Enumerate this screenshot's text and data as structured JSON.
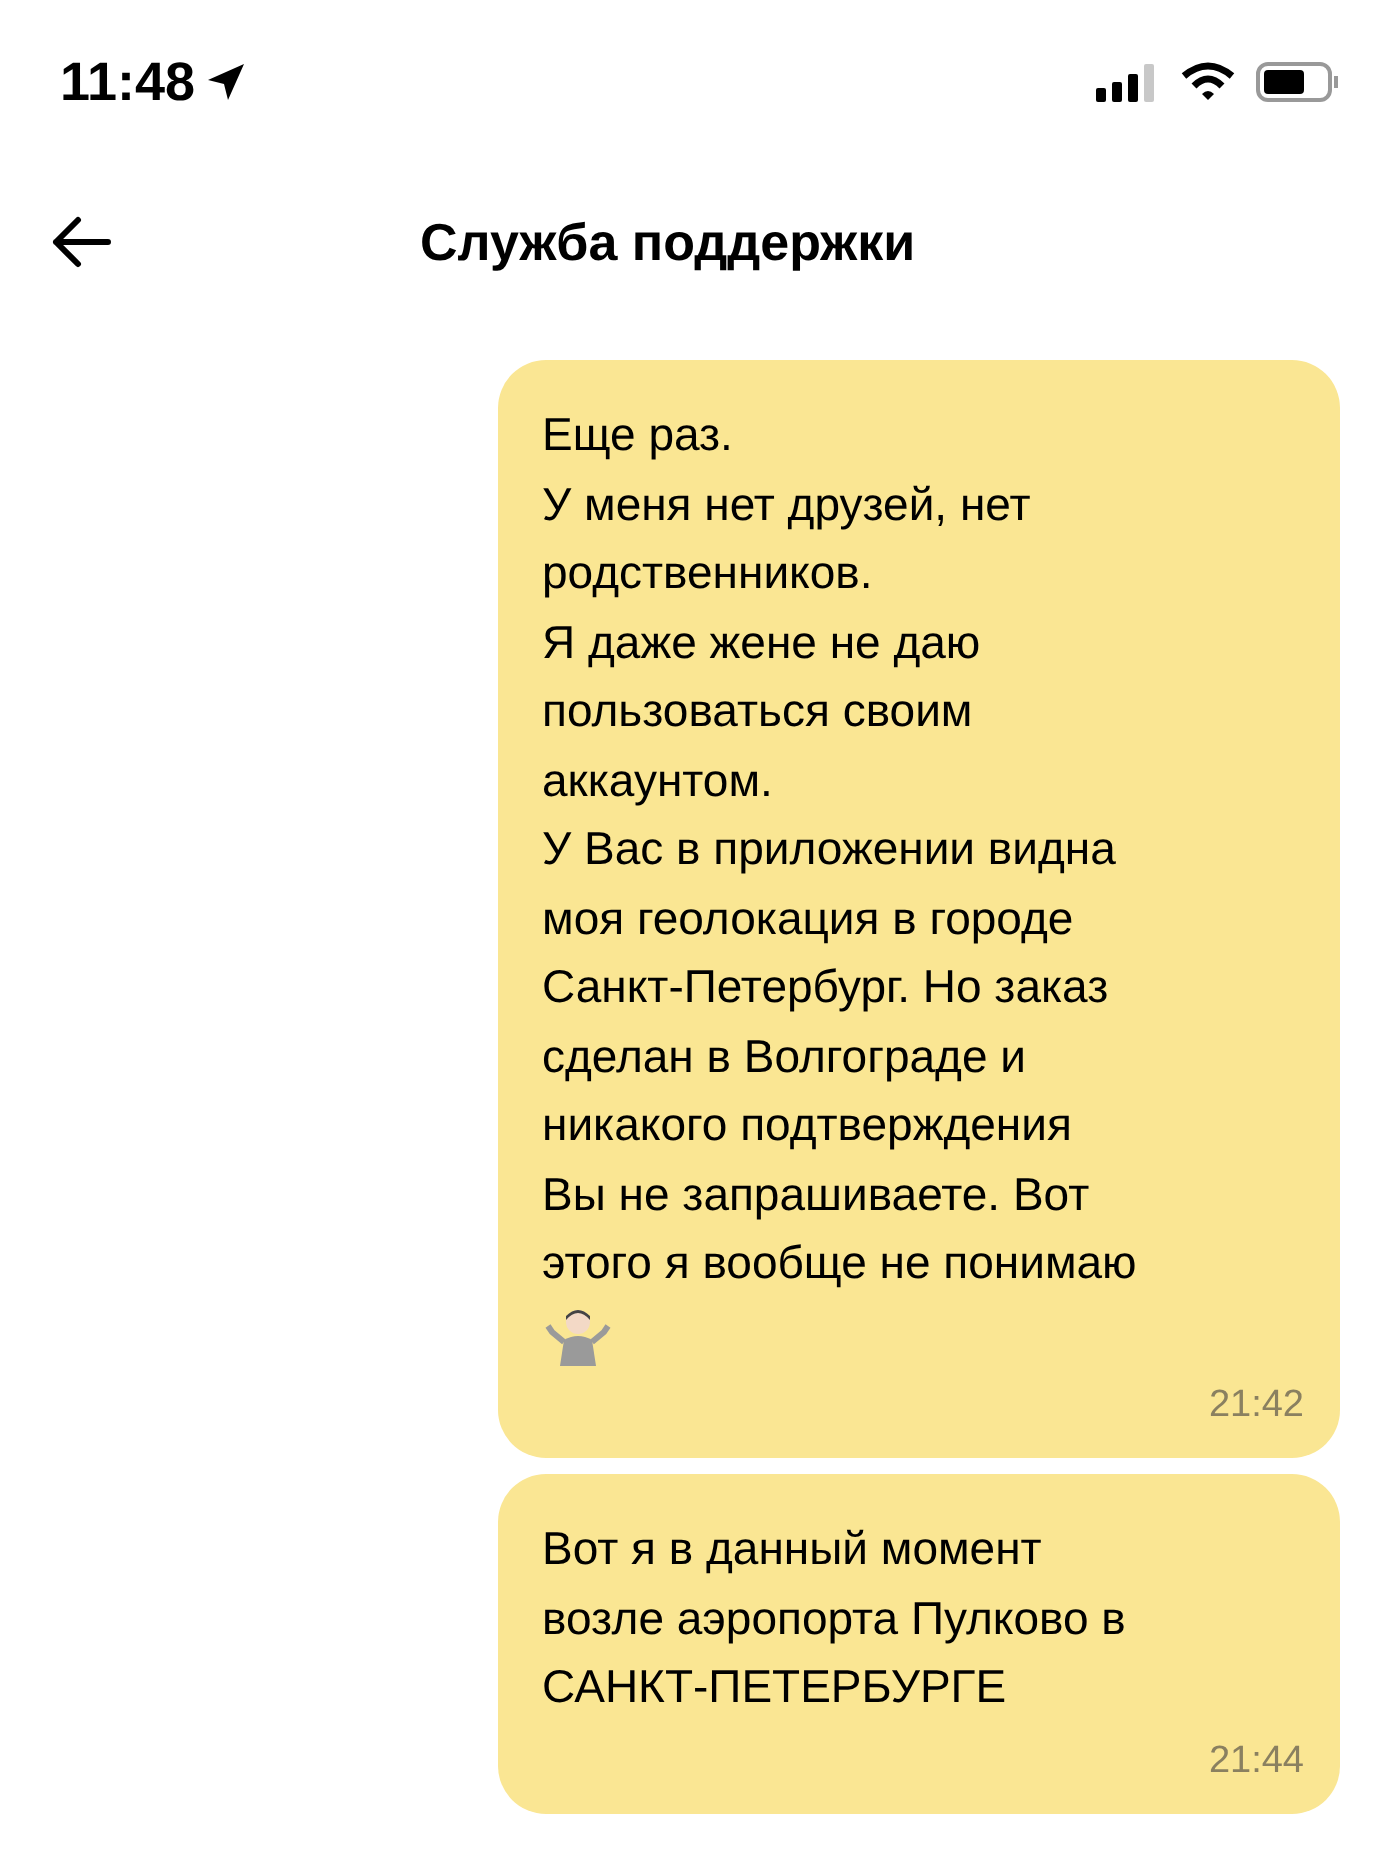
{
  "status_bar": {
    "time": "11:48"
  },
  "header": {
    "title": "Служба поддержки"
  },
  "messages": [
    {
      "parts": [
        {
          "kind": "text",
          "text": "Еще раз.\nУ меня нет друзей, нет\nродственников.\nЯ даже жене не даю\nпользоваться своим\nаккаунтом.\nУ Вас в приложении видна\nмоя геолокация в городе\nСанкт-Петербург. Но заказ\nсделан в Волгограде и\nникакого подтверждения\nВы не запрашиваете. Вот\nэтого я вообще не понимаю"
        },
        {
          "kind": "shrug"
        }
      ],
      "time": "21:42"
    },
    {
      "parts": [
        {
          "kind": "text",
          "text": "Вот я в данный момент\nвозле аэропорта Пулково в\nСАНКТ-ПЕТЕРБУРГЕ"
        }
      ],
      "time": "21:44"
    }
  ]
}
